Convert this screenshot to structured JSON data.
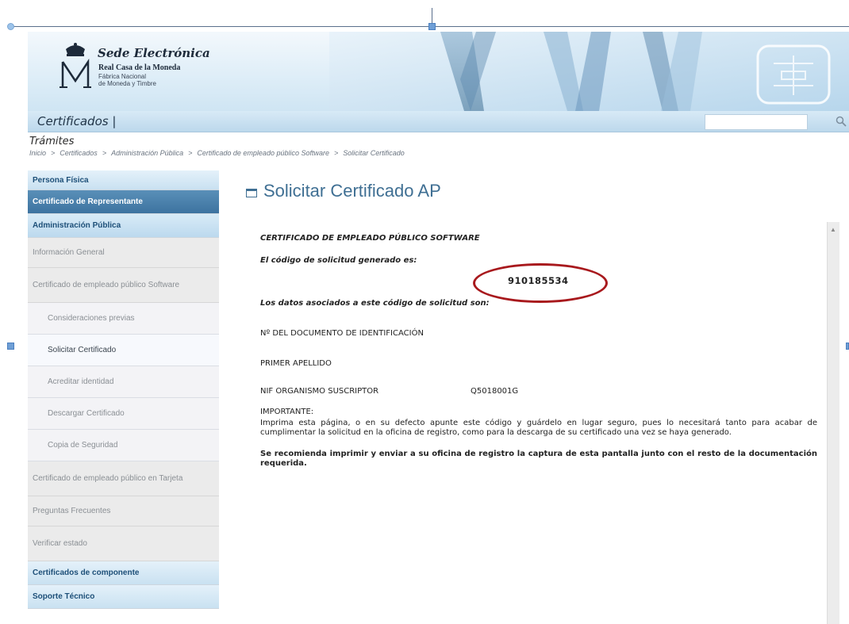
{
  "header": {
    "brand_title": "Sede Electrónica",
    "brand_sub1": "Real Casa de la Moneda",
    "brand_sub2": "Fábrica Nacional",
    "brand_sub3": "de Moneda y Timbre",
    "nav_label": "Certificados  |",
    "search_placeholder": ""
  },
  "breadcrumb": {
    "section": "Trámites",
    "items": [
      "Inicio",
      "Certificados",
      "Administración Pública",
      "Certificado de empleado público Software",
      "Solicitar Certificado"
    ],
    "separator": ">"
  },
  "sidebar": {
    "items": [
      {
        "label": "Persona Física"
      },
      {
        "label": "Certificado de Representante"
      },
      {
        "label": "Administración Pública"
      },
      {
        "label": "Información General"
      },
      {
        "label": "Certificado de empleado público Software"
      },
      {
        "label": "Consideraciones previas"
      },
      {
        "label": "Solicitar Certificado"
      },
      {
        "label": "Acreditar identidad"
      },
      {
        "label": "Descargar Certificado"
      },
      {
        "label": "Copia de Seguridad"
      },
      {
        "label": "Certificado de empleado público en Tarjeta"
      },
      {
        "label": "Preguntas Frecuentes"
      },
      {
        "label": "Verificar estado"
      },
      {
        "label": "Certificados de componente"
      },
      {
        "label": "Soporte Técnico"
      }
    ]
  },
  "main": {
    "title": "Solicitar Certificado AP",
    "heading": "CERTIFICADO DE EMPLEADO PÚBLICO SOFTWARE",
    "code_label": "El código de solicitud generado es:",
    "code_value": "910185534",
    "assoc_label": "Los datos asociados a este código de solicitud son:",
    "field1": "Nº DEL DOCUMENTO DE IDENTIFICACIÓN",
    "field2": "PRIMER APELLIDO",
    "field3_label": "NIF ORGANISMO SUSCRIPTOR",
    "field3_value": "Q5018001G",
    "important_label": "IMPORTANTE:",
    "important_text": "Imprima esta página, o en su defecto apunte este código y guárdelo en lugar seguro, pues lo necesitará tanto para acabar de cumplimentar la solicitud en la oficina de registro, como para la descarga de su certificado una vez se haya generado.",
    "recommend_text": "Se recomienda imprimir y enviar a su oficina de registro la captura de esta pantalla junto con el resto de la documentación requerida."
  },
  "colors": {
    "accent": "#3f6f93",
    "active_nav": "#3d73a0",
    "highlight_oval": "#a8191d"
  }
}
